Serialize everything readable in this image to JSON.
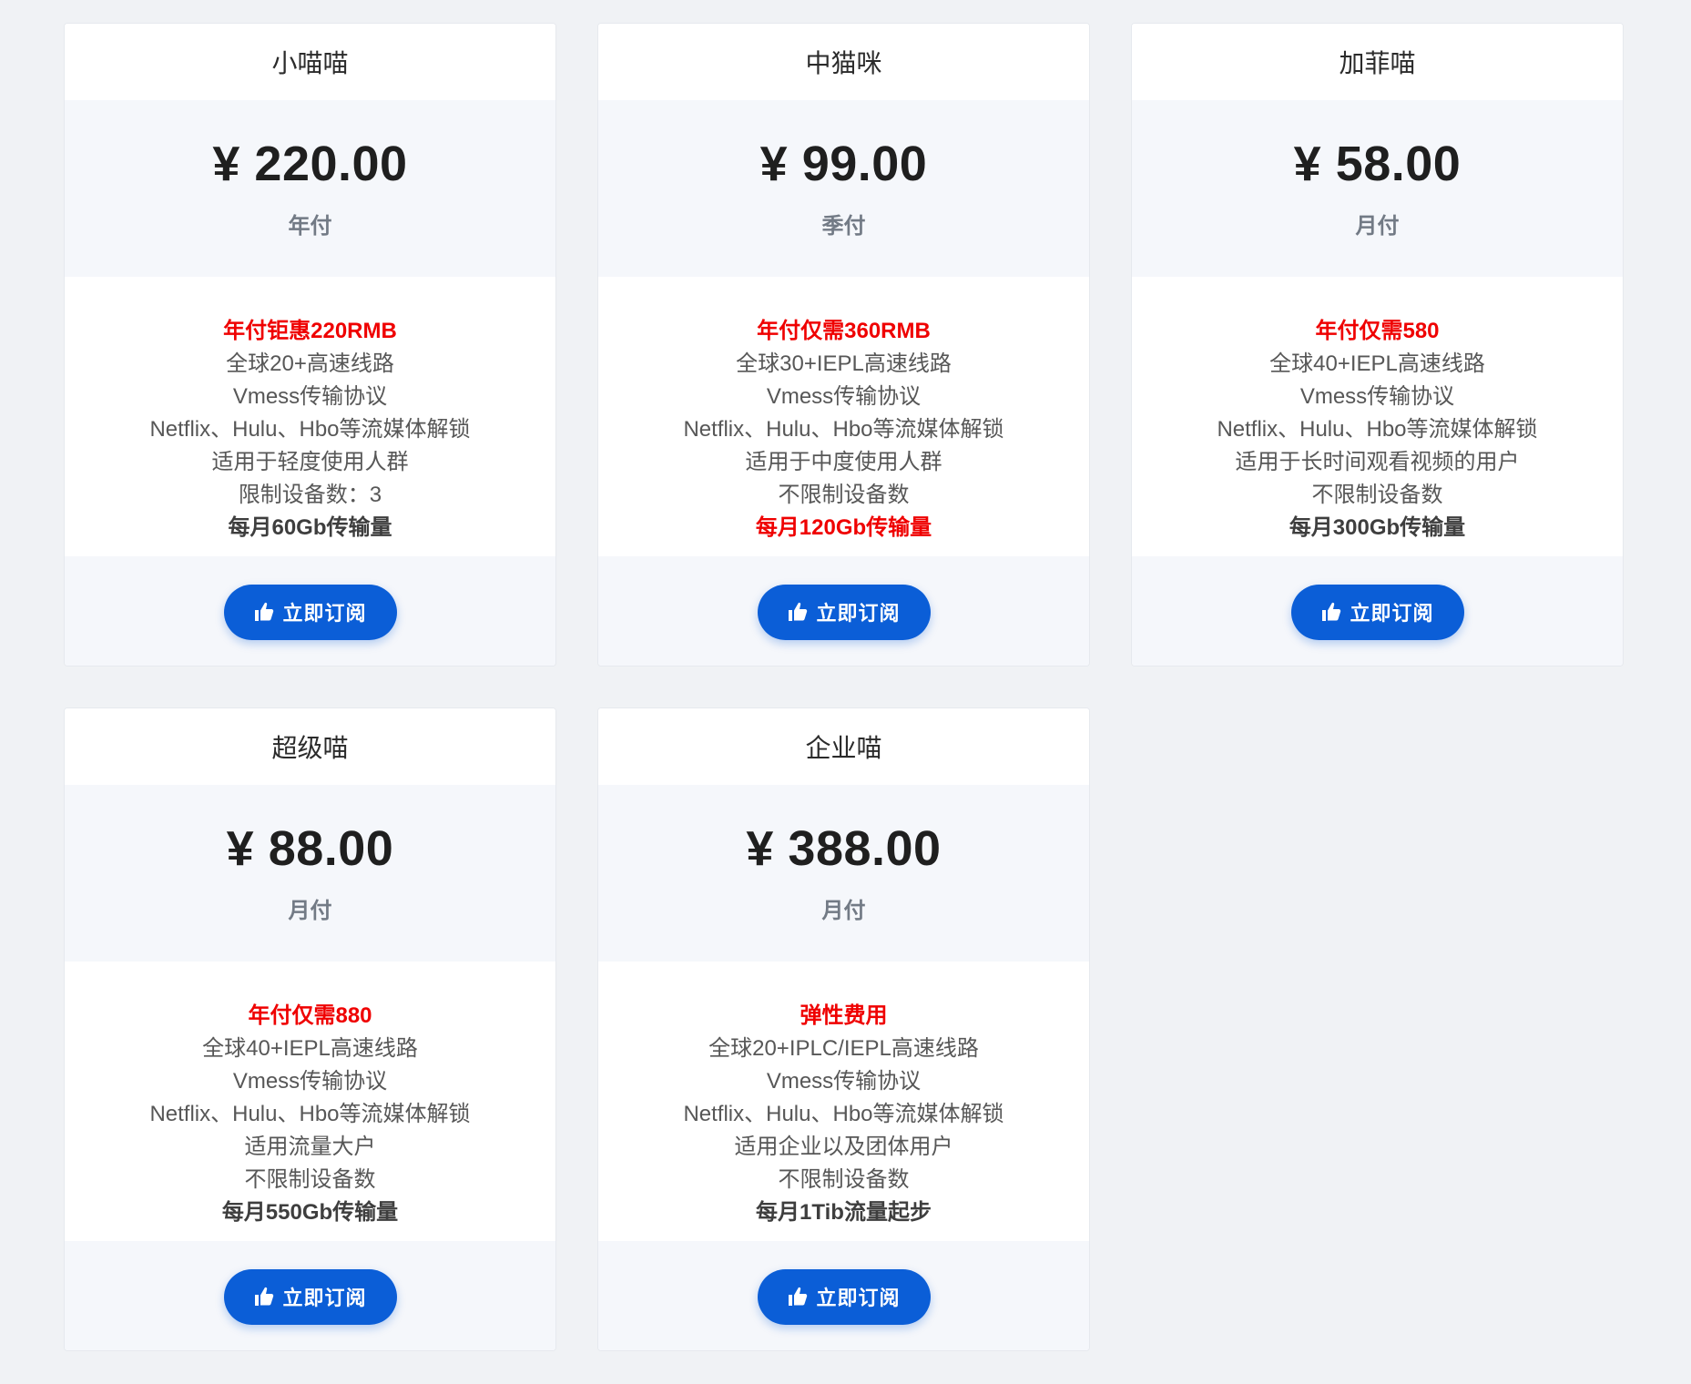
{
  "plans": [
    {
      "name": "小喵喵",
      "price": "¥ 220.00",
      "period": "年付",
      "features": [
        {
          "text": "年付钜惠220RMB",
          "style": "highlight"
        },
        {
          "text": "全球20+高速线路",
          "style": "normal"
        },
        {
          "text": "Vmess传输协议",
          "style": "normal"
        },
        {
          "text": "Netflix、Hulu、Hbo等流媒体解锁",
          "style": "normal"
        },
        {
          "text": "适用于轻度使用人群",
          "style": "normal"
        },
        {
          "text": "限制设备数：3",
          "style": "normal"
        },
        {
          "text": "每月60Gb传输量",
          "style": "strong"
        }
      ],
      "button_label": "立即订阅",
      "button_icon": "thumbs-up-icon"
    },
    {
      "name": "中猫咪",
      "price": "¥ 99.00",
      "period": "季付",
      "features": [
        {
          "text": "年付仅需360RMB",
          "style": "highlight"
        },
        {
          "text": "全球30+IEPL高速线路",
          "style": "normal"
        },
        {
          "text": "Vmess传输协议",
          "style": "normal"
        },
        {
          "text": "Netflix、Hulu、Hbo等流媒体解锁",
          "style": "normal"
        },
        {
          "text": "适用于中度使用人群",
          "style": "normal"
        },
        {
          "text": "不限制设备数",
          "style": "normal"
        },
        {
          "text": "每月120Gb传输量",
          "style": "strong-red"
        }
      ],
      "button_label": "立即订阅",
      "button_icon": "thumbs-up-icon"
    },
    {
      "name": "加菲喵",
      "price": "¥ 58.00",
      "period": "月付",
      "features": [
        {
          "text": "年付仅需580",
          "style": "highlight"
        },
        {
          "text": "全球40+IEPL高速线路",
          "style": "normal"
        },
        {
          "text": "Vmess传输协议",
          "style": "normal"
        },
        {
          "text": "Netflix、Hulu、Hbo等流媒体解锁",
          "style": "normal"
        },
        {
          "text": "适用于长时间观看视频的用户",
          "style": "normal"
        },
        {
          "text": "不限制设备数",
          "style": "normal"
        },
        {
          "text": "每月300Gb传输量",
          "style": "strong"
        }
      ],
      "button_label": "立即订阅",
      "button_icon": "thumbs-up-icon"
    },
    {
      "name": "超级喵",
      "price": "¥ 88.00",
      "period": "月付",
      "features": [
        {
          "text": "年付仅需880",
          "style": "highlight"
        },
        {
          "text": "全球40+IEPL高速线路",
          "style": "normal"
        },
        {
          "text": "Vmess传输协议",
          "style": "normal"
        },
        {
          "text": "Netflix、Hulu、Hbo等流媒体解锁",
          "style": "normal"
        },
        {
          "text": "适用流量大户",
          "style": "normal"
        },
        {
          "text": "不限制设备数",
          "style": "normal"
        },
        {
          "text": "每月550Gb传输量",
          "style": "strong"
        }
      ],
      "button_label": "立即订阅",
      "button_icon": "thumbs-up-icon"
    },
    {
      "name": "企业喵",
      "price": "¥ 388.00",
      "period": "月付",
      "features": [
        {
          "text": "弹性费用",
          "style": "highlight"
        },
        {
          "text": "全球20+IPLC/IEPL高速线路",
          "style": "normal"
        },
        {
          "text": "Vmess传输协议",
          "style": "normal"
        },
        {
          "text": "Netflix、Hulu、Hbo等流媒体解锁",
          "style": "normal"
        },
        {
          "text": "适用企业以及团体用户",
          "style": "normal"
        },
        {
          "text": "不限制设备数",
          "style": "normal"
        },
        {
          "text": "每月1Tib流量起步",
          "style": "strong"
        }
      ],
      "button_label": "立即订阅",
      "button_icon": "thumbs-up-icon"
    }
  ]
}
